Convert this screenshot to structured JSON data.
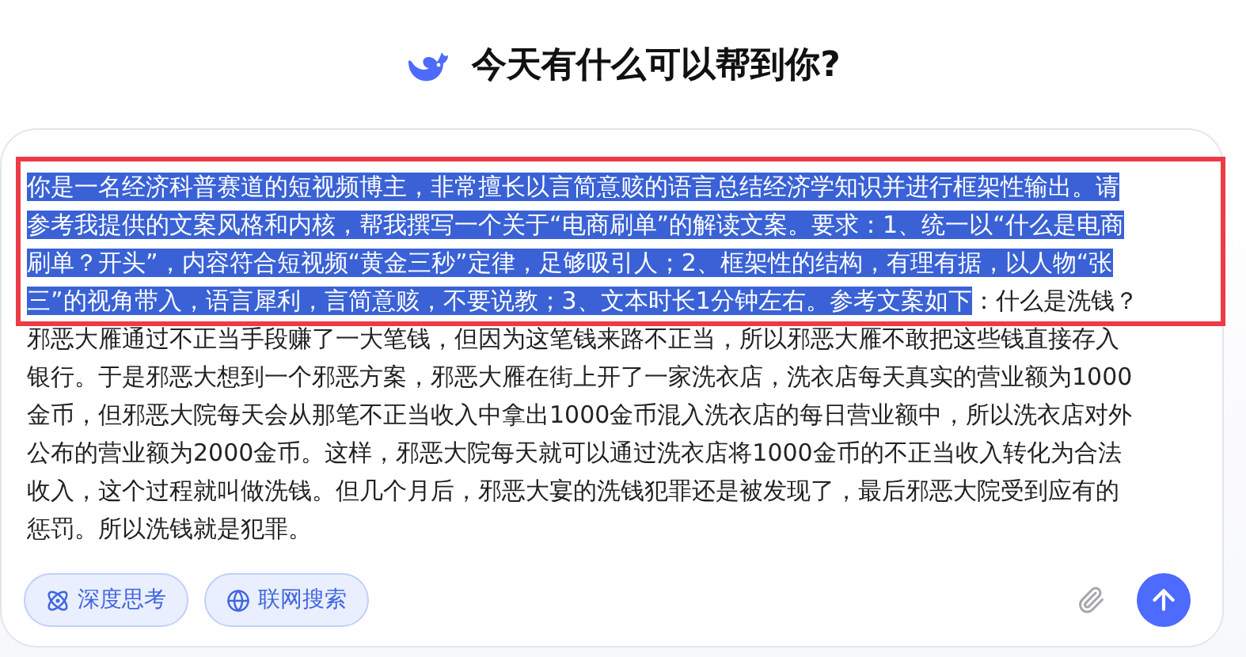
{
  "heading": "今天有什么可以帮到你?",
  "composer": {
    "lines": [
      [
        {
          "text": "你是一名经济科普赛道的短视频博主，非常擅长以言简意赅的语言总结经济学知识并进行框架性输出。请",
          "selected": true
        }
      ],
      [
        {
          "text": "参考我提供的文案风格和内核，帮我撰写一个关于“电商刷单”的解读文案。要求：1、统一以“什么是电商",
          "selected": true
        }
      ],
      [
        {
          "text": "刷单？开头”，内容符合短视频“黄金三秒”定律，足够吸引人；2、框架性的结构，有理有据，以人物“张",
          "selected": true
        }
      ],
      [
        {
          "text": "三”的视角带入，语言犀利，言简意赅，不要说教；3、文本时长1分钟左右。参考文案如下",
          "selected": true
        },
        {
          "text": "：什么是洗钱？",
          "selected": false
        }
      ],
      [
        {
          "text": "邪恶大雁通过不正当手段赚了一大笔钱，但因为这笔钱来路不正当，所以邪恶大雁不敢把这些钱直接存入",
          "selected": false
        }
      ],
      [
        {
          "text": "银行。于是邪恶大想到一个邪恶方案，邪恶大雁在街上开了一家洗衣店，洗衣店每天真实的营业额为1000",
          "selected": false
        }
      ],
      [
        {
          "text": "金币，但邪恶大院每天会从那笔不正当收入中拿出1000金币混入洗衣店的每日营业额中，所以洗衣店对外",
          "selected": false
        }
      ],
      [
        {
          "text": "公布的营业额为2000金币。这样，邪恶大院每天就可以通过洗衣店将1000金币的不正当收入转化为合法",
          "selected": false
        }
      ],
      [
        {
          "text": "收入，这个过程就叫做洗钱。但几个月后，邪恶大宴的洗钱犯罪还是被发现了，最后邪恶大院受到应有的",
          "selected": false
        }
      ],
      [
        {
          "text": "惩罚。所以洗钱就是犯罪。",
          "selected": false
        }
      ]
    ],
    "toggles": [
      {
        "kind": "deep-think",
        "label": "深度思考",
        "selected": true
      },
      {
        "kind": "web-search",
        "label": "联网搜索",
        "selected": true
      }
    ]
  }
}
